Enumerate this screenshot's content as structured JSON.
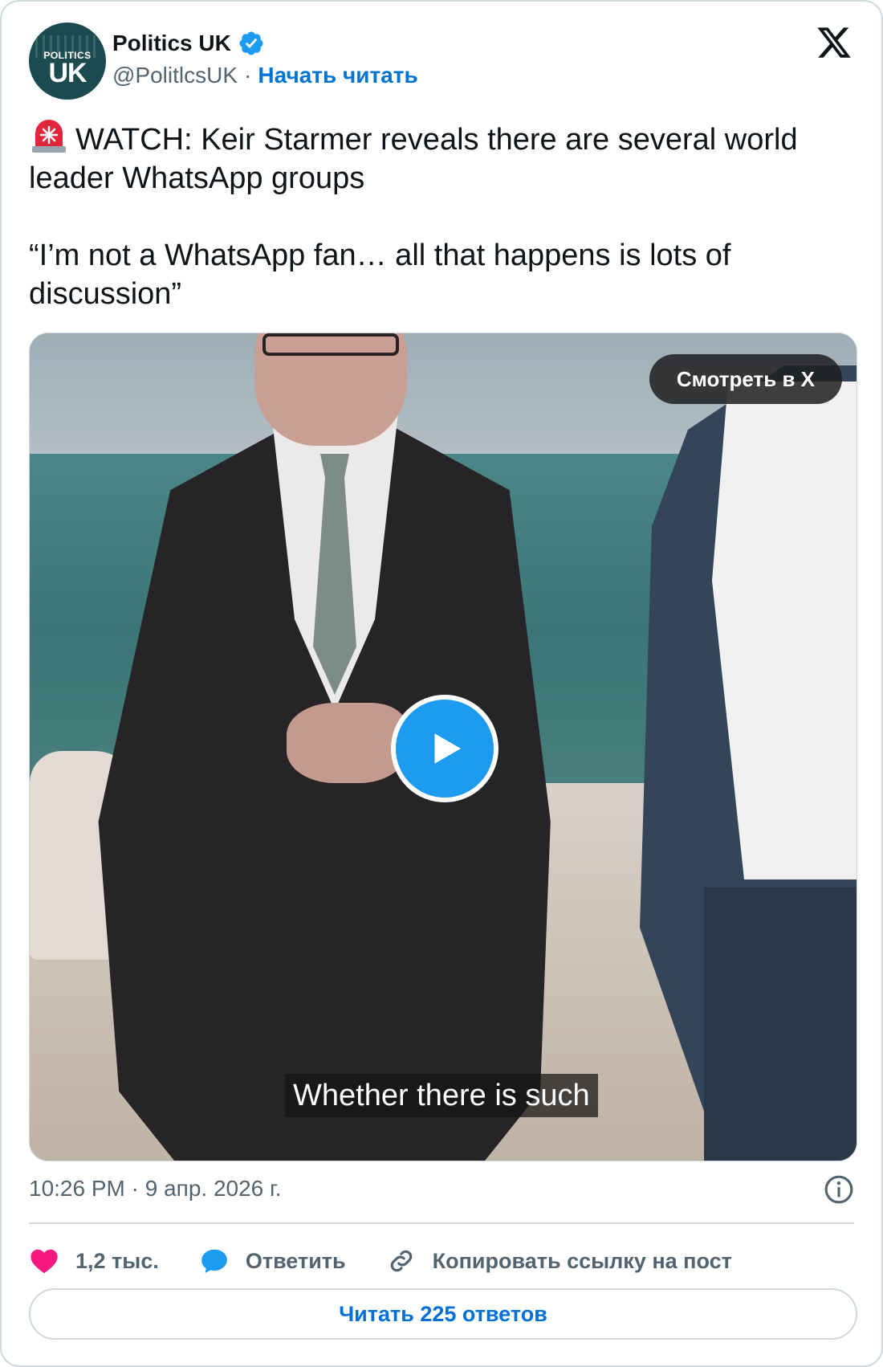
{
  "author": {
    "name": "Politics UK",
    "handle": "@PolitlcsUK",
    "separator": "·",
    "follow_label": "Начать читать",
    "avatar_text_top": "POLITICS",
    "avatar_text_bottom": "UK",
    "verified_icon": "verified-badge-icon"
  },
  "tweet": {
    "line1": "WATCH: Keir Starmer reveals there are several world leader WhatsApp groups",
    "line2": "“I’m not a WhatsApp fan… all that happens is lots of discussion”",
    "emoji_icon": "siren-icon"
  },
  "media": {
    "watch_label": "Смотреть в X",
    "caption": "Whether there is such",
    "play_icon": "play-icon"
  },
  "meta": {
    "timestamp": "10:26 PM · 9 апр. 2026 г."
  },
  "actions": {
    "likes": "1,2 тыс.",
    "reply": "Ответить",
    "copy": "Копировать ссылку на пост"
  },
  "replies": {
    "label": "Читать 225 ответов"
  },
  "colors": {
    "accent": "#1d9bf0",
    "link": "#006fd6",
    "like": "#f91880",
    "muted": "#536471",
    "border": "#cfd9de"
  }
}
